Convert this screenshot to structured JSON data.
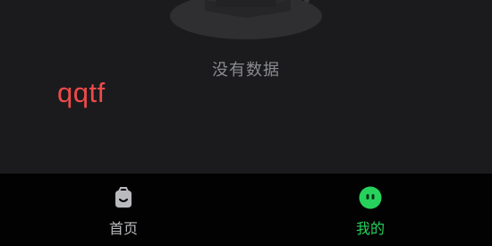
{
  "empty_state": {
    "message": "没有数据",
    "illustration_icon": "empty-box-illustration"
  },
  "watermark": {
    "text": "qqtf",
    "color": "#f04a4a"
  },
  "tabbar": {
    "tabs": [
      {
        "label": "首页",
        "icon": "home-bag-icon",
        "active": false,
        "color": "#b9babe"
      },
      {
        "label": "我的",
        "icon": "smiley-face-icon",
        "active": true,
        "color": "#27d25c"
      }
    ]
  },
  "theme": {
    "background": "#1b1b1d",
    "tabbar_background": "#020202",
    "active_color": "#27d25c",
    "inactive_color": "#b9babe"
  }
}
